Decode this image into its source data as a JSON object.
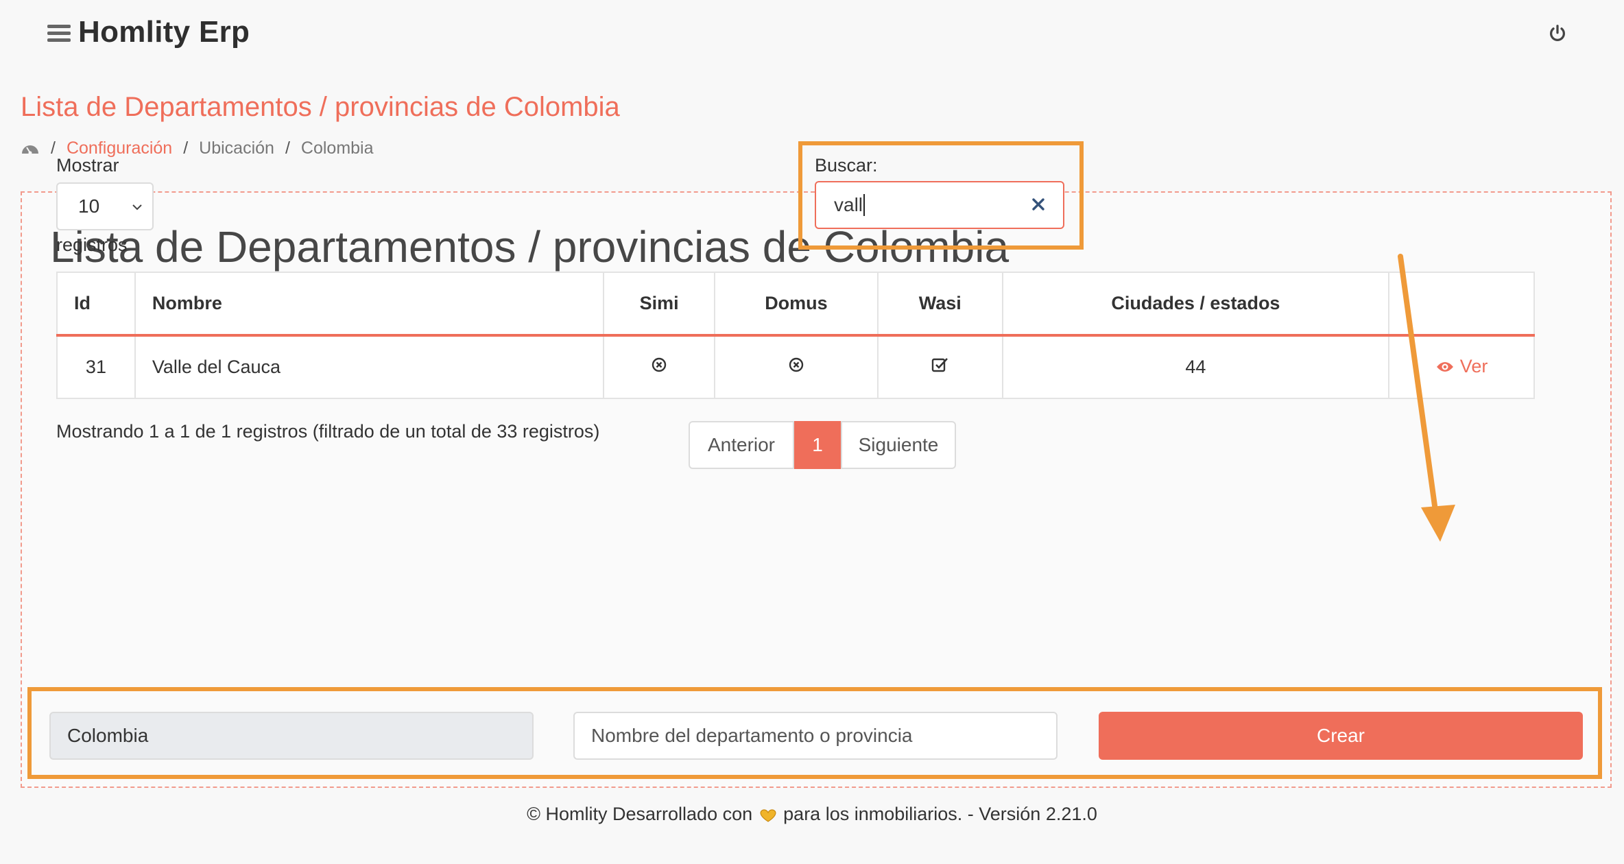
{
  "app": {
    "title": "Homlity Erp"
  },
  "page": {
    "title": "Lista de Departamentos / provincias de Colombia"
  },
  "breadcrumb": {
    "items": [
      "Configuración",
      "Ubicación",
      "Colombia"
    ]
  },
  "card": {
    "title": "Lista de Departamentos / provincias de Colombia"
  },
  "length_menu": {
    "label_before": "Mostrar",
    "value": "10",
    "label_after": "registros"
  },
  "search": {
    "label": "Buscar:",
    "value": "vall"
  },
  "table": {
    "headers": [
      "Id",
      "Nombre",
      "Simi",
      "Domus",
      "Wasi",
      "Ciudades / estados",
      ""
    ],
    "rows": [
      {
        "id": "31",
        "nombre": "Valle del Cauca",
        "simi": "x-circle-icon",
        "domus": "x-circle-icon",
        "wasi": "check-square-icon",
        "ciudades": "44",
        "action": "Ver"
      }
    ]
  },
  "info": {
    "text": "Mostrando 1 a 1 de 1 registros (filtrado de un total de 33 registros)"
  },
  "pagination": {
    "previous": "Anterior",
    "current": "1",
    "next": "Siguiente"
  },
  "create_form": {
    "country": "Colombia",
    "name_placeholder": "Nombre del departamento o provincia",
    "submit_label": "Crear"
  },
  "footer": {
    "prefix": "© Homlity Desarrollado con",
    "suffix": "para los inmobiliarios. - Versión 2.21.0"
  },
  "colors": {
    "accent": "#ef6e5a",
    "annotation": "#ef9a39"
  }
}
